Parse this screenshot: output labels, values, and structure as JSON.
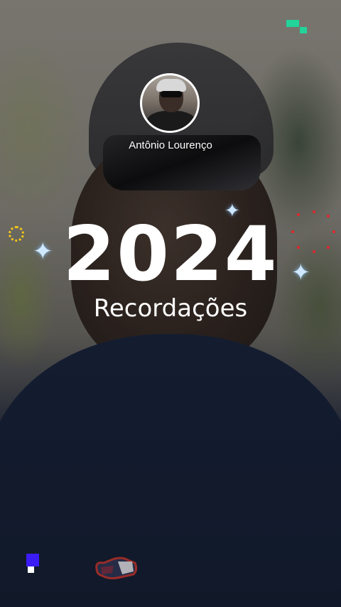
{
  "profile": {
    "name": "Antônio Lourenço"
  },
  "story": {
    "year": "2024",
    "subtitle": "Recordações"
  },
  "colors": {
    "sparkle": "#cfe8ff",
    "ring_yellow": "#f5c518",
    "dots_red": "#e0262b",
    "accent_green": "#22d39a",
    "accent_blue": "#3b1cf5"
  },
  "icons": {
    "sparkle": "sparkle-icon",
    "ring": "dotted-ring-icon",
    "dots": "red-dots-icon"
  }
}
